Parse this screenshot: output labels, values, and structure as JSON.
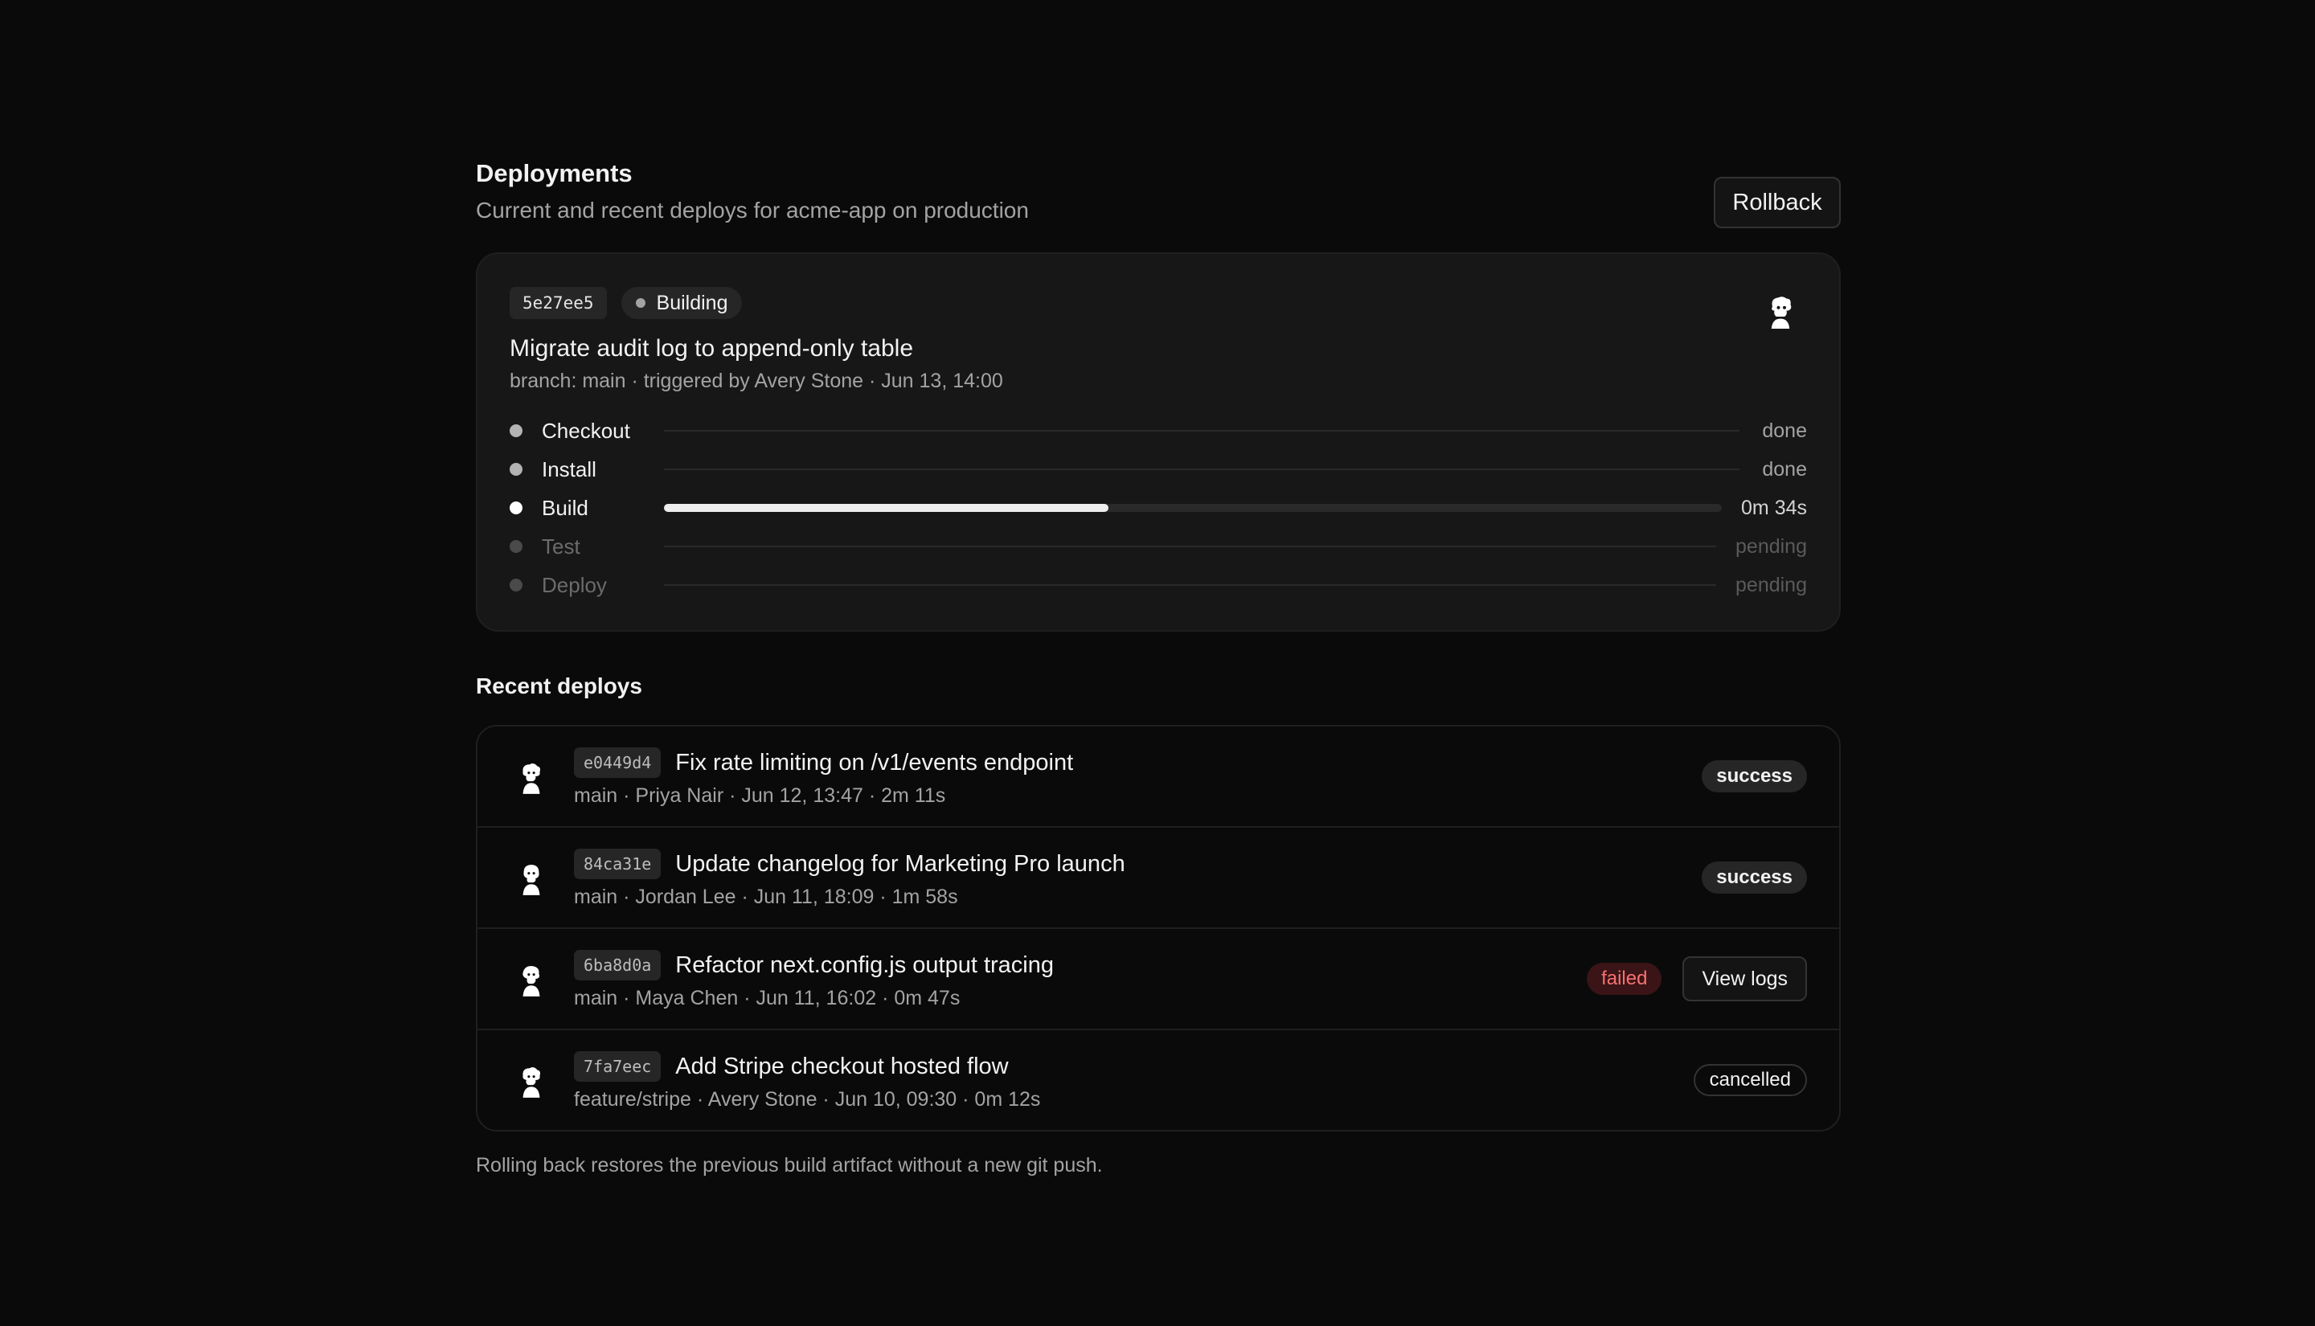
{
  "header": {
    "title": "Deployments",
    "subtitle": "Current and recent deploys for acme-app on production",
    "rollback_label": "Rollback"
  },
  "current": {
    "sha": "5e27ee5",
    "status": "Building",
    "message": "Migrate audit log to append-only table",
    "meta": "branch: main · triggered by Avery Stone · Jun 13, 14:00",
    "avatar_icon": "avatar-icon",
    "build_progress": 0.42,
    "steps": [
      {
        "label": "Checkout",
        "status": "done"
      },
      {
        "label": "Install",
        "status": "done"
      },
      {
        "label": "Build",
        "status": "0m 34s"
      },
      {
        "label": "Test",
        "status": "pending"
      },
      {
        "label": "Deploy",
        "status": "pending"
      }
    ]
  },
  "recent": {
    "title": "Recent deploys",
    "items": [
      {
        "sha": "e0449d4",
        "message": "Fix rate limiting on /v1/events endpoint",
        "meta": "main · Priya Nair · Jun 12, 13:47 · 2m 11s",
        "status": "success"
      },
      {
        "sha": "84ca31e",
        "message": "Update changelog for Marketing Pro launch",
        "meta": "main · Jordan Lee · Jun 11, 18:09 · 1m 58s",
        "status": "success"
      },
      {
        "sha": "6ba8d0a",
        "message": "Refactor next.config.js output tracing",
        "meta": "main · Maya Chen · Jun 11, 16:02 · 0m 47s",
        "status": "failed",
        "action": "View logs"
      },
      {
        "sha": "7fa7eec",
        "message": "Add Stripe checkout hosted flow",
        "meta": "feature/stripe · Avery Stone · Jun 10, 09:30 · 0m 12s",
        "status": "cancelled"
      }
    ]
  },
  "footnote": "Rolling back restores the previous build artifact without a new git push.",
  "colors": {
    "background": "#0a0a0a",
    "card": "#171717",
    "failed": "#f87171",
    "progress": "#eeeeee"
  }
}
